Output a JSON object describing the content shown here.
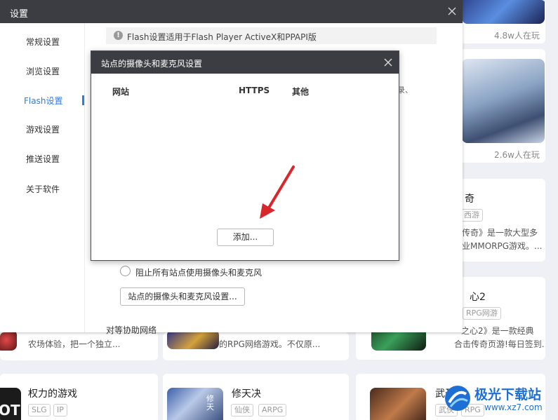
{
  "settings_window": {
    "title": "设置",
    "nav": [
      {
        "label": "常规设置"
      },
      {
        "label": "浏览设置"
      },
      {
        "label": "Flash设置"
      },
      {
        "label": "游戏设置"
      },
      {
        "label": "推送设置"
      },
      {
        "label": "关于软件"
      }
    ],
    "active_nav": "Flash设置",
    "notice_icon": "!",
    "notice": "Flash设置适用于Flash Player ActiveX和PPAPI版",
    "cut_text": "录、",
    "block_option_label": "阻止所有站点使用摄像头和麦克风",
    "site_settings_button": "站点的摄像头和麦克风设置...",
    "section_label": "对等协助网络"
  },
  "dialog": {
    "title": "站点的摄像头和麦克风设置",
    "columns": [
      "网站",
      "HTTPS",
      "其他"
    ],
    "add_button": "添加..."
  },
  "background": {
    "top_right_players": "4.8w人在玩",
    "mid_right_players": "2.6w人在玩",
    "card3": {
      "title_partial": "奇",
      "tag_partial": "西游",
      "desc_line1": "传奇》是一款大型多",
      "desc_line2": "业MMORPG游戏。..."
    },
    "card4": {
      "title_partial": "心2",
      "tag_partial": "RPG网游",
      "desc_line1": "之心2》是一款经典",
      "desc_line2": "合击传奇页游!每日签到..."
    },
    "left_fragment": "农场体验，把一个独立...",
    "mid_fragment": "的RPG网络游戏。不仅原...",
    "bottom_left": {
      "title": "权力的游戏",
      "tags": [
        "SLG",
        "IP"
      ],
      "art_text": "OT"
    },
    "bottom_mid": {
      "title": "修天决",
      "tags": [
        "仙侠",
        "ARPG"
      ],
      "art_text": "修天"
    },
    "bottom_right": {
      "title_partial": "武圣传",
      "tags": [
        "武侠",
        "RPG"
      ]
    }
  },
  "watermark": {
    "text": "极光下载站",
    "url": "www.xz7.com"
  },
  "colors": {
    "titlebar": "#3b3d42",
    "accent": "#2f7ae5",
    "arrow": "#d9262b",
    "logo_blue": "#1d6fd6"
  }
}
